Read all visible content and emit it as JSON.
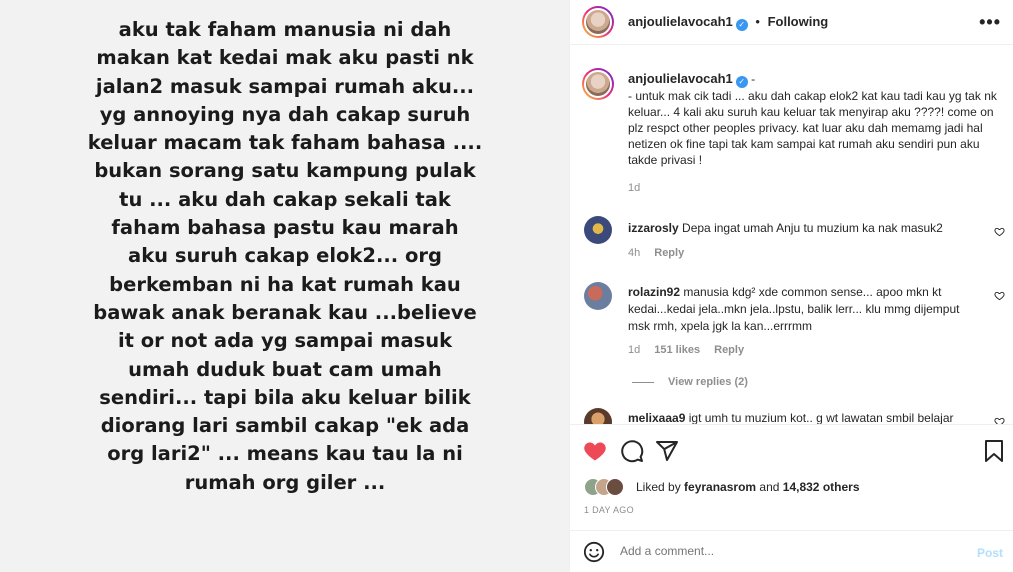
{
  "story": {
    "text": "aku tak faham manusia ni dah\nmakan kat kedai mak aku pasti nk\njalan2 masuk sampai rumah aku...\nyg annoying nya dah cakap suruh\nkeluar macam tak faham bahasa ....\nbukan sorang satu kampung pulak\ntu ... aku dah cakap sekali tak\nfaham bahasa pastu kau marah\naku suruh cakap elok2... org\nberkemban ni ha kat rumah kau\nbawak anak beranak kau ...believe\nit or not ada yg sampai masuk\numah duduk buat cam umah\nsendiri... tapi bila aku keluar bilik\ndiorang lari sambil cakap \"ek ada\norg lari2\" ... means kau tau la ni\nrumah org giler ..."
  },
  "header": {
    "username": "anjoulielavocah1",
    "separator": "•",
    "follow_label": "Following",
    "more_icon": "more-horizontal-icon"
  },
  "caption": {
    "username": "anjoulielavocah1",
    "suffix": " -",
    "text": "- untuk mak cik tadi ... aku dah cakap elok2 kat kau tadi kau yg tak nk keluar... 4 kali aku suruh kau keluar tak menyirap aku ????! come on plz respct other peoples privacy. kat luar aku dah memamg jadi hal netizen ok fine tapi tak kam sampai kat rumah aku sendiri pun aku takde privasi !",
    "time": "1d"
  },
  "comments": [
    {
      "username": "izzarosly",
      "text": "Depa ingat umah Anju tu muzium ka nak masuk2",
      "time": "4h",
      "likes": "",
      "reply": "Reply"
    },
    {
      "username": "rolazin92",
      "text": "manusia kdg² xde common sense... apoo mkn kt kedai...kedai jela..mkn jela..lpstu, balik lerr... klu mmg dijemput msk rmh, xpela jgk la kan...errrmm",
      "time": "1d",
      "likes": "151 likes",
      "reply": "Reply",
      "view_replies": "View replies (2)"
    },
    {
      "username": "melixaaa9",
      "text": "igt umh tu muzium kot.. g wt lawatan smbil belajar",
      "time": "",
      "likes": "",
      "reply": ""
    }
  ],
  "actions": {
    "liked_by_prefix": "Liked by ",
    "liked_by_user": "feyranasrom",
    "and": " and ",
    "others": "14,832 others",
    "date": "1 DAY AGO"
  },
  "add_comment": {
    "placeholder": "Add a comment...",
    "post_label": "Post"
  },
  "colors": {
    "like_red": "#ed4956",
    "verified_blue": "#3897f0",
    "post_disabled": "#b2dffc"
  }
}
